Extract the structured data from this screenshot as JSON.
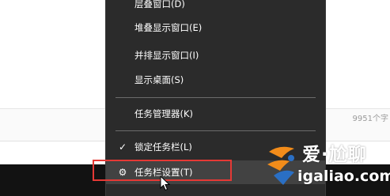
{
  "background": {
    "word_count_text": "9951个字"
  },
  "context_menu": {
    "items": [
      {
        "label": "层叠窗口(D)"
      },
      {
        "label": "堆叠显示窗口(E)"
      },
      {
        "label": "并排显示窗口(I)"
      },
      {
        "label": "显示桌面(S)"
      },
      {
        "label": "任务管理器(K)"
      },
      {
        "label": "锁定任务栏(L)",
        "check_icon": "✓"
      },
      {
        "label": "任务栏设置(T)",
        "icon": "gear-icon",
        "icon_glyph": "⚙"
      }
    ]
  },
  "watermark": {
    "title": "爱·尬聊",
    "url": "igaliao.com"
  },
  "colors": {
    "menu_bg": "#2b2b2b",
    "menu_text": "#ffffff",
    "highlight_bg": "#424242",
    "annotation_red": "#e53935",
    "logo_orange": "#f28c1a",
    "logo_blue": "#2a6fc4"
  }
}
